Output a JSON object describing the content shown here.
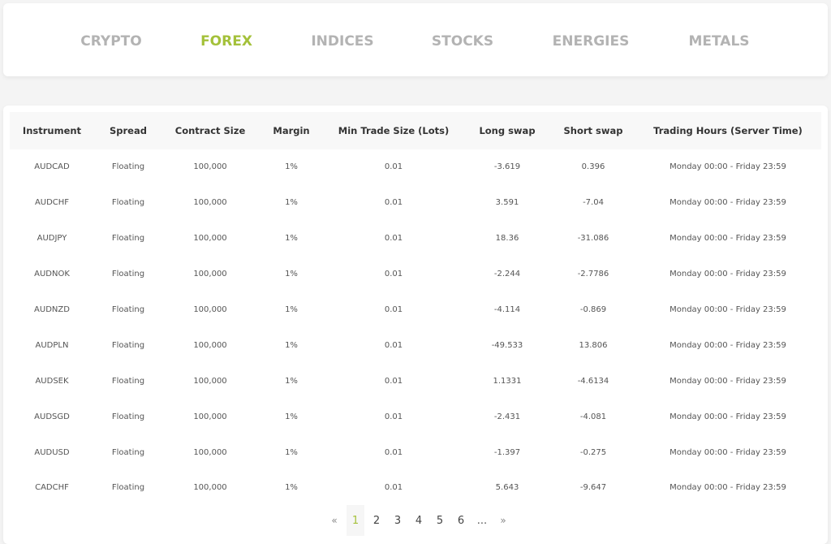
{
  "tabs": [
    {
      "label": "CRYPTO",
      "active": false
    },
    {
      "label": "FOREX",
      "active": true
    },
    {
      "label": "INDICES",
      "active": false
    },
    {
      "label": "STOCKS",
      "active": false
    },
    {
      "label": "ENERGIES",
      "active": false
    },
    {
      "label": "METALS",
      "active": false
    }
  ],
  "accent_color": "#a4c13a",
  "table": {
    "headers": [
      "Instrument",
      "Spread",
      "Contract Size",
      "Margin",
      "Min Trade Size (Lots)",
      "Long swap",
      "Short swap",
      "Trading Hours (Server Time)"
    ],
    "rows": [
      [
        "AUDCAD",
        "Floating",
        "100,000",
        "1%",
        "0.01",
        "-3.619",
        "0.396",
        "Monday 00:00 - Friday 23:59"
      ],
      [
        "AUDCHF",
        "Floating",
        "100,000",
        "1%",
        "0.01",
        "3.591",
        "-7.04",
        "Monday 00:00 - Friday 23:59"
      ],
      [
        "AUDJPY",
        "Floating",
        "100,000",
        "1%",
        "0.01",
        "18.36",
        "-31.086",
        "Monday 00:00 - Friday 23:59"
      ],
      [
        "AUDNOK",
        "Floating",
        "100,000",
        "1%",
        "0.01",
        "-2.244",
        "-2.7786",
        "Monday 00:00 - Friday 23:59"
      ],
      [
        "AUDNZD",
        "Floating",
        "100,000",
        "1%",
        "0.01",
        "-4.114",
        "-0.869",
        "Monday 00:00 - Friday 23:59"
      ],
      [
        "AUDPLN",
        "Floating",
        "100,000",
        "1%",
        "0.01",
        "-49.533",
        "13.806",
        "Monday 00:00 - Friday 23:59"
      ],
      [
        "AUDSEK",
        "Floating",
        "100,000",
        "1%",
        "0.01",
        "1.1331",
        "-4.6134",
        "Monday 00:00 - Friday 23:59"
      ],
      [
        "AUDSGD",
        "Floating",
        "100,000",
        "1%",
        "0.01",
        "-2.431",
        "-4.081",
        "Monday 00:00 - Friday 23:59"
      ],
      [
        "AUDUSD",
        "Floating",
        "100,000",
        "1%",
        "0.01",
        "-1.397",
        "-0.275",
        "Monday 00:00 - Friday 23:59"
      ],
      [
        "CADCHF",
        "Floating",
        "100,000",
        "1%",
        "0.01",
        "5.643",
        "-9.647",
        "Monday 00:00 - Friday 23:59"
      ]
    ]
  },
  "pagination": {
    "prev": "«",
    "next": "»",
    "pages": [
      "1",
      "2",
      "3",
      "4",
      "5",
      "6"
    ],
    "ellipsis": "...",
    "current": "1"
  }
}
